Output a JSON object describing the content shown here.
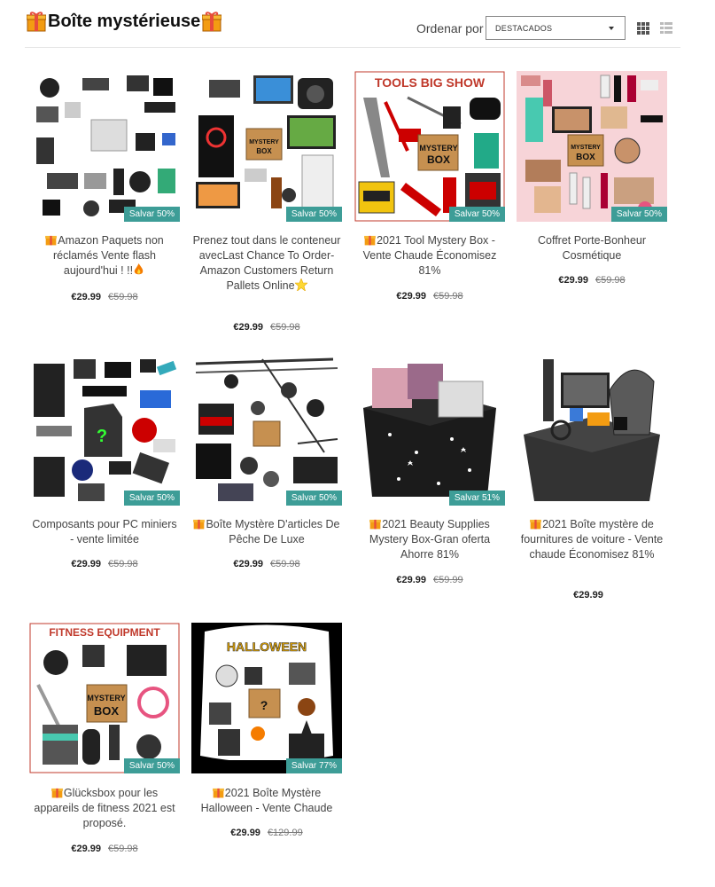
{
  "header": {
    "title": "Boîte mystérieuse",
    "sort_label": "Ordenar por",
    "sort_value": "DESTACADOS"
  },
  "products": [
    {
      "name": "Amazon Paquets non réclamés Vente flash aujourd'hui ! !!",
      "price": "€29.99",
      "old_price": "€59.98",
      "badge": "Salvar 50%"
    },
    {
      "name": "Prenez tout dans le conteneur avecLast Chance To Order- Amazon Customers Return Pallets Online",
      "price": "€29.99",
      "old_price": "€59.98",
      "badge": "Salvar 50%"
    },
    {
      "name": "2021 Tool Mystery Box - Vente Chaude Économisez 81%",
      "price": "€29.99",
      "old_price": "€59.98",
      "badge": "Salvar 50%"
    },
    {
      "name": "Coffret Porte-Bonheur Cosmétique",
      "price": "€29.99",
      "old_price": "€59.98",
      "badge": "Salvar 50%"
    },
    {
      "name": "Composants pour PC miniers - vente limitée",
      "price": "€29.99",
      "old_price": "€59.98",
      "badge": "Salvar 50%"
    },
    {
      "name": "Boîte Mystère D'articles De Pêche De Luxe",
      "price": "€29.99",
      "old_price": "€59.98",
      "badge": "Salvar 50%"
    },
    {
      "name": "2021 Beauty Supplies Mystery Box-Gran oferta Ahorre 81%",
      "price": "€29.99",
      "old_price": "€59.99",
      "badge": "Salvar 51%"
    },
    {
      "name": "2021 Boîte mystère de fournitures de voiture - Vente chaude Économisez 81%",
      "price": "€29.99",
      "old_price": "",
      "badge": ""
    },
    {
      "name": "Glücksbox pour les appareils de fitness 2021 est proposé.",
      "price": "€29.99",
      "old_price": "€59.98",
      "badge": "Salvar 50%"
    },
    {
      "name": "2021 Boîte Mystère Halloween - Vente Chaude",
      "price": "€29.99",
      "old_price": "€129.99",
      "badge": "Salvar 77%"
    }
  ],
  "thumb_text": {
    "tools": "TOOLS BIG SHOW",
    "fitness": "FITNESS EQUIPMENT",
    "halloween": "HALLOWEEN",
    "mystery": "MYSTERY",
    "box": "BOX"
  },
  "colors": {
    "badge": "#3d9d97",
    "gift": "#f39c12"
  },
  "icons": [
    "gift-icon",
    "grid-view-icon",
    "list-view-icon",
    "dropdown-caret-icon"
  ]
}
